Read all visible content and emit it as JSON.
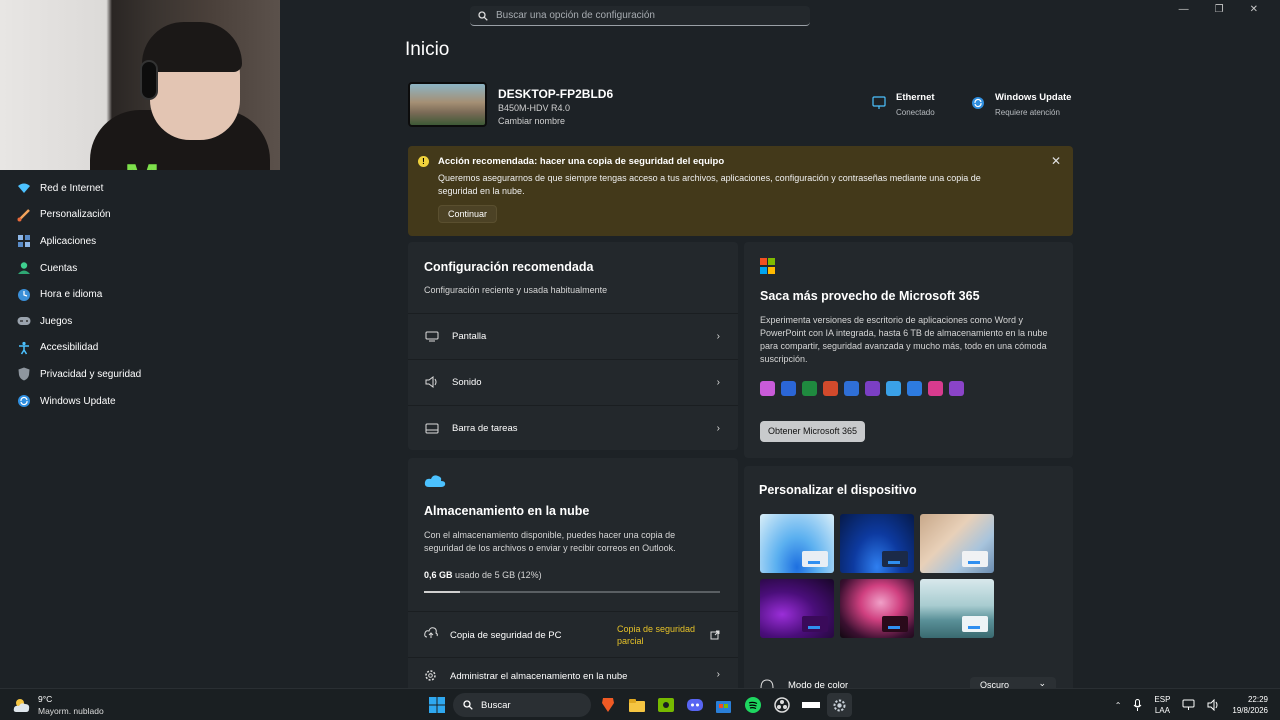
{
  "search": {
    "placeholder": "Buscar una opción de configuración"
  },
  "page": {
    "title": "Inicio"
  },
  "sidebar": {
    "items": [
      {
        "label": "Red e Internet",
        "icon": "wifi-icon"
      },
      {
        "label": "Personalización",
        "icon": "brush-icon"
      },
      {
        "label": "Aplicaciones",
        "icon": "apps-icon"
      },
      {
        "label": "Cuentas",
        "icon": "person-icon"
      },
      {
        "label": "Hora e idioma",
        "icon": "globe-clock-icon"
      },
      {
        "label": "Juegos",
        "icon": "gamepad-icon"
      },
      {
        "label": "Accesibilidad",
        "icon": "accessibility-icon"
      },
      {
        "label": "Privacidad y seguridad",
        "icon": "shield-icon"
      },
      {
        "label": "Windows Update",
        "icon": "sync-icon"
      }
    ]
  },
  "device": {
    "name": "DESKTOP-FP2BLD6",
    "model": "B450M-HDV R4.0",
    "rename": "Cambiar nombre"
  },
  "status": {
    "ethernet_title": "Ethernet",
    "ethernet_sub": "Conectado",
    "update_title": "Windows Update",
    "update_sub": "Requiere atención"
  },
  "banner": {
    "title": "Acción recomendada: hacer una copia de seguridad del equipo",
    "body": "Queremos asegurarnos de que siempre tengas acceso a tus archivos, aplicaciones, configuración y contraseñas mediante una copia de seguridad en la nube.",
    "button": "Continuar",
    "close": "✕"
  },
  "recommended": {
    "title": "Configuración recomendada",
    "subtitle": "Configuración reciente y usada habitualmente",
    "rows": [
      {
        "label": "Pantalla"
      },
      {
        "label": "Sonido"
      },
      {
        "label": "Barra de tareas"
      }
    ]
  },
  "m365": {
    "title": "Saca más provecho de Microsoft 365",
    "body": "Experimenta versiones de escritorio de aplicaciones como Word y PowerPoint con IA integrada, hasta 6 TB de almacenamiento en la nube para compartir, seguridad avanzada y mucho más, todo en una cómoda suscripción.",
    "button": "Obtener Microsoft 365",
    "app_colors": [
      "#c95bd9",
      "#2b66d6",
      "#1f8a3f",
      "#d24a2c",
      "#2f6fd6",
      "#7b3fc4",
      "#3aa1e8",
      "#2d7be0",
      "#d83b8e",
      "#8a44c8"
    ]
  },
  "cloud": {
    "title": "Almacenamiento en la nube",
    "body": "Con el almacenamiento disponible, puedes hacer una copia de seguridad de los archivos o enviar y recibir correos en Outlook.",
    "used": "0,6 GB",
    "used_suffix": "usado de 5 GB (12%)",
    "used_fraction": 0.12,
    "backup_label": "Copia de seguridad de PC",
    "backup_status": "Copia de seguridad parcial",
    "manage_label": "Administrar el almacenamiento en la nube"
  },
  "personalize": {
    "title": "Personalizar el dispositivo",
    "color_mode_label": "Modo de color",
    "color_mode_value": "Oscuro",
    "chevron": "⌄"
  },
  "taskbar": {
    "temp": "9°C",
    "weather": "Mayorm. nublado",
    "search": "Buscar",
    "lang1": "ESP",
    "lang2": "LAA",
    "time": "22:29",
    "date": "19/8/2026"
  },
  "colors": {
    "accent": "#4cc2ff",
    "banner_bg": "#43391a",
    "warning": "#f0d23c",
    "backup_status": "#e6c229"
  }
}
